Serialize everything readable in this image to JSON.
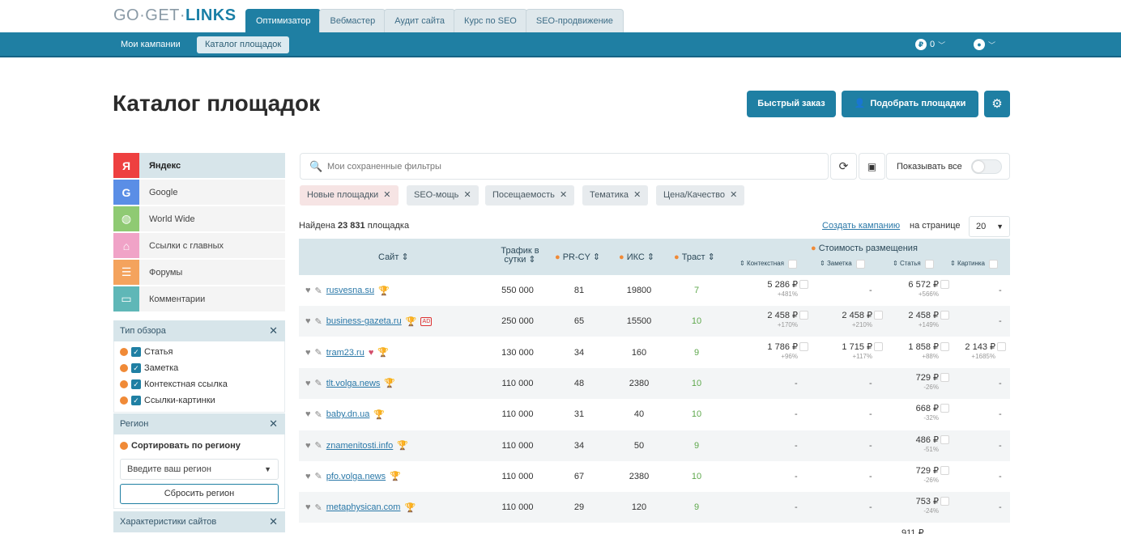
{
  "logo": {
    "left": "GO·GET·",
    "right": "LINKS"
  },
  "tabs": [
    "Оптимизатор",
    "Вебмастер",
    "Аудит сайта",
    "Курс по SEO",
    "SEO-продвижение"
  ],
  "subnav": [
    "Мои кампании",
    "Каталог площадок"
  ],
  "header": {
    "balance": "0"
  },
  "page": {
    "title": "Каталог площадок",
    "quick_order": "Быстрый заказ",
    "pick_sites": "Подобрать площадки"
  },
  "sidebar": {
    "items": [
      {
        "label": "Яндекс",
        "icon": "Я",
        "color": "#ee4040"
      },
      {
        "label": "Google",
        "icon": "G",
        "color": "#5a8ee6"
      },
      {
        "label": "World Wide",
        "icon": "◍",
        "color": "#8fca73"
      },
      {
        "label": "Ссылки с главных",
        "icon": "⌂",
        "color": "#f0a3c7"
      },
      {
        "label": "Форумы",
        "icon": "☰",
        "color": "#f4a35d"
      },
      {
        "label": "Комментарии",
        "icon": "▭",
        "color": "#5fb7b7"
      }
    ],
    "review_type": {
      "title": "Тип обзора",
      "options": [
        "Статья",
        "Заметка",
        "Контекстная ссылка",
        "Ссылки-картинки"
      ]
    },
    "region": {
      "title": "Регион",
      "sort_label": "Сортировать по региону",
      "placeholder": "Введите ваш регион",
      "reset": "Сбросить регион"
    },
    "characteristics": {
      "title": "Характеристики сайтов"
    }
  },
  "filters": {
    "search_placeholder": "Мои сохраненные фильтры",
    "show_all": "Показывать все",
    "chips": [
      "Новые площадки",
      "SEO-мощь",
      "Посещаемость",
      "Тематика",
      "Цена/Качество"
    ]
  },
  "summary": {
    "found_prefix": "Найдена",
    "found_count": "23 831",
    "found_suffix": "площадка",
    "create_campaign": "Создать кампанию",
    "per_page_label": "на странице",
    "per_page": "20"
  },
  "table": {
    "headers": {
      "site": "Сайт",
      "traffic": "Трафик в сутки",
      "prcy": "PR-CY",
      "iks": "ИКС",
      "trust": "Траст",
      "cost": "Стоимость размещения",
      "context": "Контекстная",
      "note": "Заметка",
      "article": "Статья",
      "image": "Картинка"
    },
    "rows": [
      {
        "site": "rusvesna.su",
        "traffic": "550 000",
        "prcy": "81",
        "iks": "19800",
        "trust": "7",
        "context": "5 286 ₽",
        "context_pct": "+481%",
        "note": "-",
        "note_pct": "",
        "article": "6 572 ₽",
        "article_pct": "+566%",
        "image": "-",
        "image_pct": "",
        "ad": false
      },
      {
        "site": "business-gazeta.ru",
        "traffic": "250 000",
        "prcy": "65",
        "iks": "15500",
        "trust": "10",
        "context": "2 458 ₽",
        "context_pct": "+170%",
        "note": "2 458 ₽",
        "note_pct": "+210%",
        "article": "2 458 ₽",
        "article_pct": "+149%",
        "image": "-",
        "image_pct": "",
        "ad": true
      },
      {
        "site": "tram23.ru",
        "traffic": "130 000",
        "prcy": "34",
        "iks": "160",
        "trust": "9",
        "context": "1 786 ₽",
        "context_pct": "+96%",
        "note": "1 715 ₽",
        "note_pct": "+117%",
        "article": "1 858 ₽",
        "article_pct": "+88%",
        "image": "2 143 ₽",
        "image_pct": "+1685%",
        "ad": false
      },
      {
        "site": "tlt.volga.news",
        "traffic": "110 000",
        "prcy": "48",
        "iks": "2380",
        "trust": "10",
        "context": "-",
        "context_pct": "",
        "note": "-",
        "note_pct": "",
        "article": "729 ₽",
        "article_pct": "-26%",
        "image": "-",
        "image_pct": "",
        "ad": false
      },
      {
        "site": "baby.dn.ua",
        "traffic": "110 000",
        "prcy": "31",
        "iks": "40",
        "trust": "10",
        "context": "-",
        "context_pct": "",
        "note": "-",
        "note_pct": "",
        "article": "668 ₽",
        "article_pct": "-32%",
        "image": "-",
        "image_pct": "",
        "ad": false
      },
      {
        "site": "znamenitosti.info",
        "traffic": "110 000",
        "prcy": "34",
        "iks": "50",
        "trust": "9",
        "context": "-",
        "context_pct": "",
        "note": "-",
        "note_pct": "",
        "article": "486 ₽",
        "article_pct": "-51%",
        "image": "-",
        "image_pct": "",
        "ad": false
      },
      {
        "site": "pfo.volga.news",
        "traffic": "110 000",
        "prcy": "67",
        "iks": "2380",
        "trust": "10",
        "context": "-",
        "context_pct": "",
        "note": "-",
        "note_pct": "",
        "article": "729 ₽",
        "article_pct": "-26%",
        "image": "-",
        "image_pct": "",
        "ad": false
      },
      {
        "site": "metaphysican.com",
        "traffic": "110 000",
        "prcy": "29",
        "iks": "120",
        "trust": "9",
        "context": "-",
        "context_pct": "",
        "note": "-",
        "note_pct": "",
        "article": "753 ₽",
        "article_pct": "-24%",
        "image": "-",
        "image_pct": "",
        "ad": false
      }
    ],
    "partial_row_article": "911 ₽"
  }
}
